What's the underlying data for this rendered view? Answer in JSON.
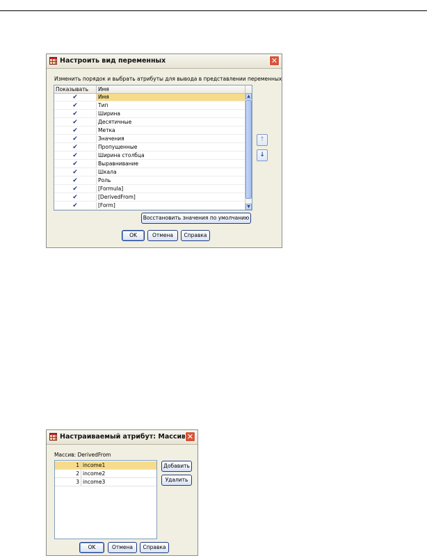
{
  "dialog1": {
    "title": "Настроить вид переменных",
    "instruction": "Изменить порядок и выбрать атрибуты для вывода в представлении переменных",
    "columns": {
      "show": "Показывать",
      "name": "Имя"
    },
    "rows": [
      {
        "checked": true,
        "name": "Имя",
        "selected": true
      },
      {
        "checked": true,
        "name": "Тип"
      },
      {
        "checked": true,
        "name": "Ширина"
      },
      {
        "checked": true,
        "name": "Десятичные"
      },
      {
        "checked": true,
        "name": "Метка"
      },
      {
        "checked": true,
        "name": "Значения"
      },
      {
        "checked": true,
        "name": "Пропущенные"
      },
      {
        "checked": true,
        "name": "Ширина столбца"
      },
      {
        "checked": true,
        "name": "Выравнивание"
      },
      {
        "checked": true,
        "name": "Шкала"
      },
      {
        "checked": true,
        "name": "Роль"
      },
      {
        "checked": true,
        "name": "[Formula]"
      },
      {
        "checked": true,
        "name": "[DerivedFrom]"
      },
      {
        "checked": true,
        "name": "[Form]"
      }
    ],
    "restore_label": "Восстановить значения по умолчанию",
    "ok_label": "OK",
    "cancel_label": "Отмена",
    "help_label": "Справка",
    "move_up_icon": "arrow-up-icon",
    "move_down_icon": "arrow-down-icon"
  },
  "dialog2": {
    "title": "Настраиваемый атрибут: Массив",
    "array_label": "Массив: DerivedFrom",
    "rows": [
      {
        "index": "1",
        "value": "income1",
        "selected": true
      },
      {
        "index": "2",
        "value": "income2"
      },
      {
        "index": "3",
        "value": "income3"
      }
    ],
    "add_label": "Добавить",
    "remove_label": "Удалить",
    "ok_label": "OK",
    "cancel_label": "Отмена",
    "help_label": "Справка"
  },
  "colors": {
    "selection": "#f6dc8a",
    "dialog_bg": "#f1efe2",
    "close": "#d8553a"
  }
}
